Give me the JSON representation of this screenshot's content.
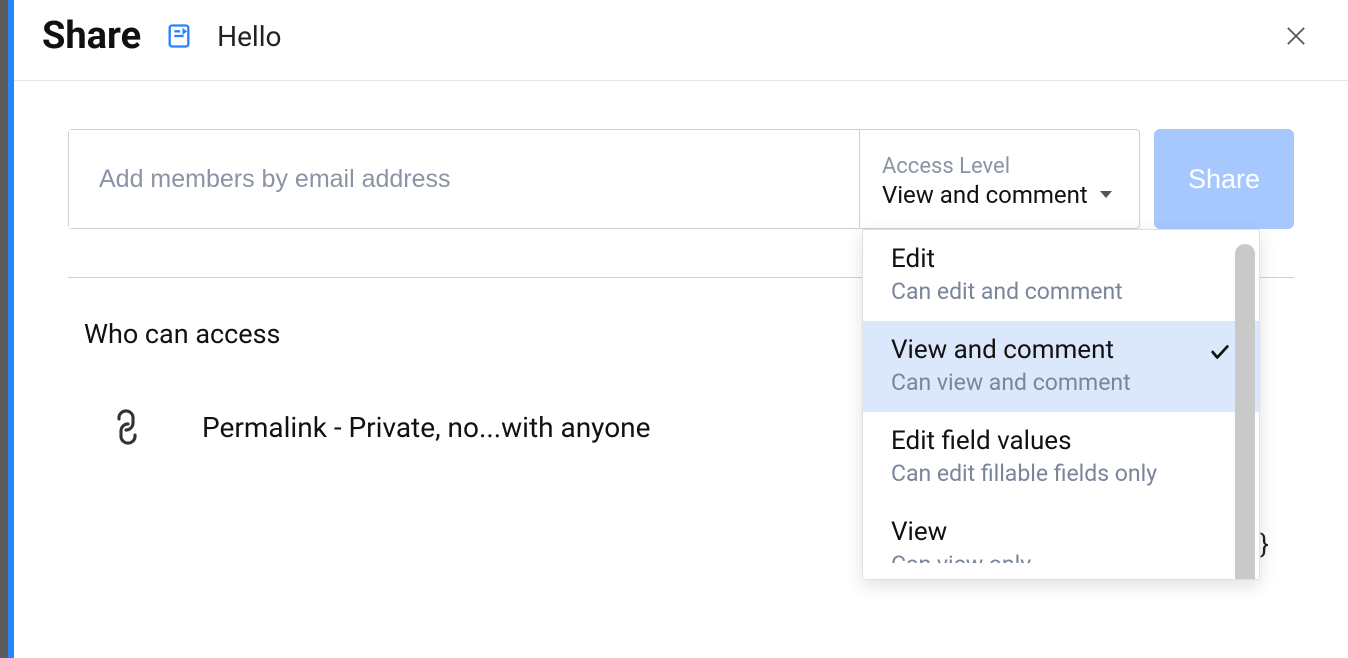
{
  "header": {
    "title": "Share",
    "doc_name": "Hello"
  },
  "input": {
    "placeholder": "Add members by email address",
    "access_label": "Access Level",
    "access_value": "View and comment"
  },
  "share_button": "Share",
  "section_title": "Who can access",
  "permalink_text": "Permalink - Private, no...with anyone",
  "dropdown": {
    "items": [
      {
        "title": "Edit",
        "desc": "Can edit and comment",
        "selected": false
      },
      {
        "title": "View and comment",
        "desc": "Can view and comment",
        "selected": true
      },
      {
        "title": "Edit field values",
        "desc": "Can edit fillable fields only",
        "selected": false
      },
      {
        "title": "View",
        "desc": "Can view only",
        "selected": false
      }
    ]
  },
  "decor_char": "}"
}
